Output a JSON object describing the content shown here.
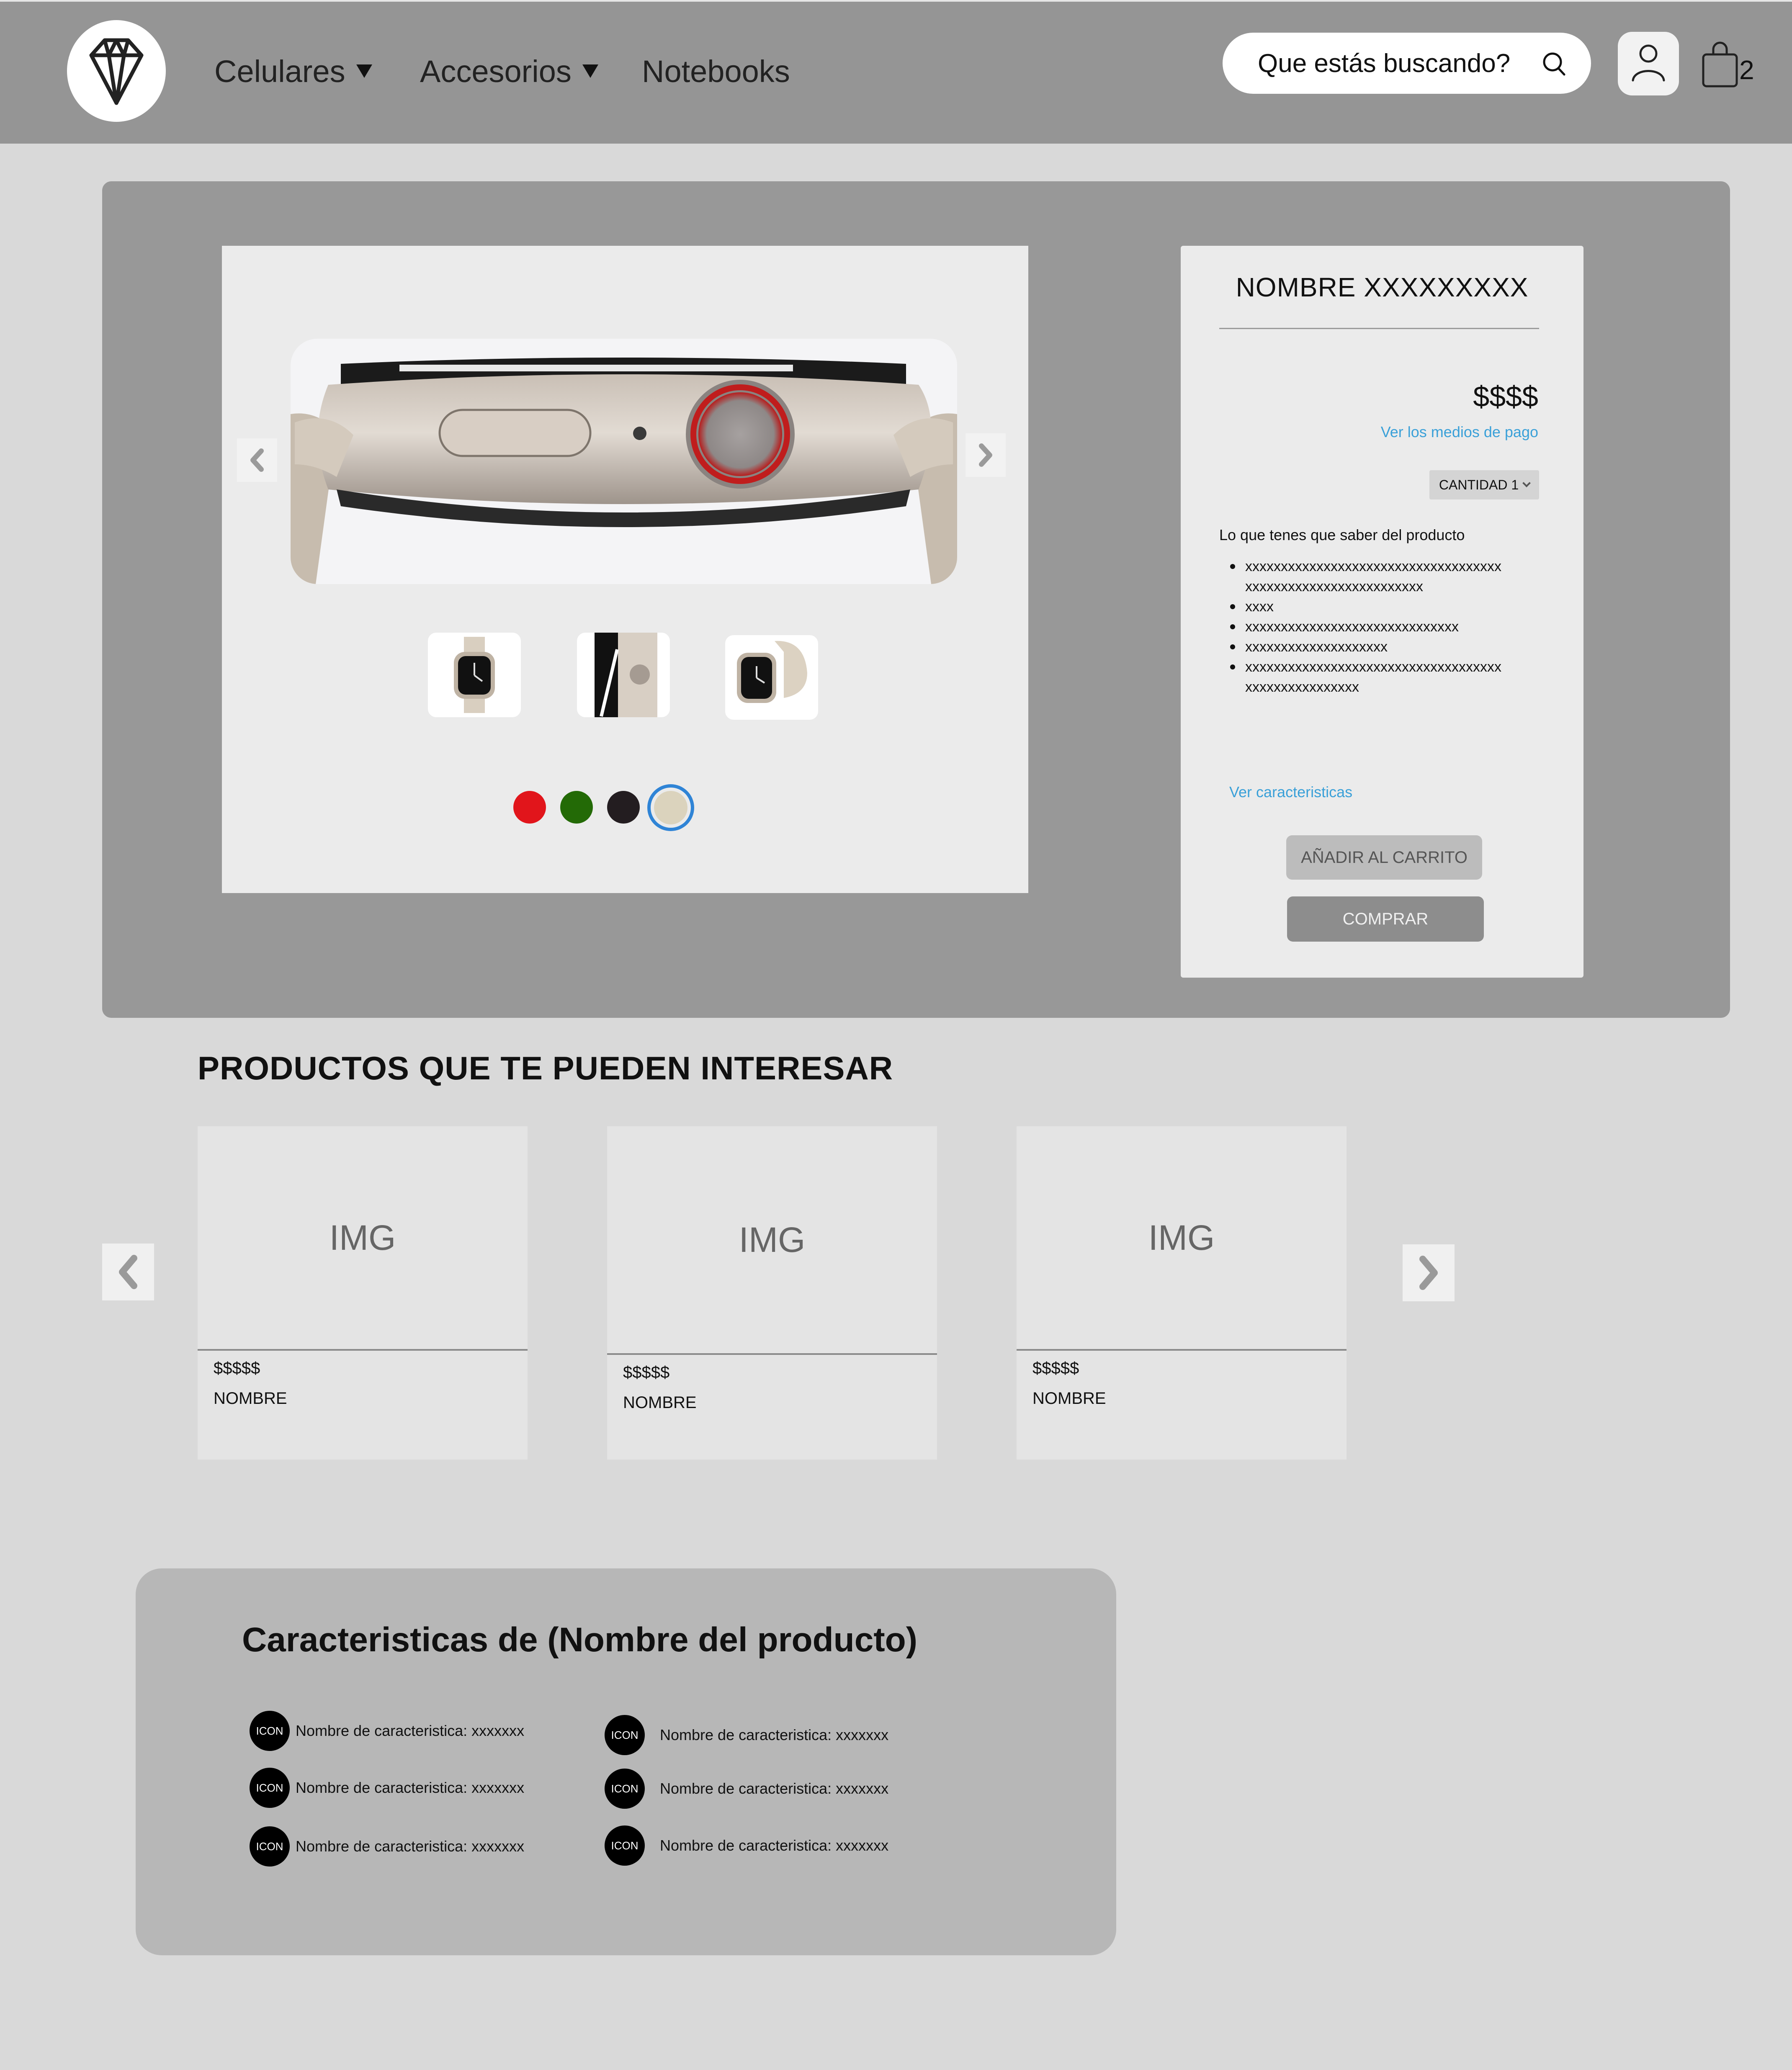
{
  "nav": {
    "items": [
      {
        "label": "Celulares"
      },
      {
        "label": "Accesorios"
      },
      {
        "label": "Notebooks"
      }
    ],
    "search_placeholder": "Que estás buscando?",
    "cart_count": "2"
  },
  "product": {
    "name": "NOMBRE XXXXXXXXX",
    "price": "$$$$",
    "payment_link": "Ver los medios de pago",
    "quantity_label": "CANTIDAD 1",
    "know_title": "Lo que tenes que saber del producto",
    "know_items": [
      "xxxxxxxxxxxxxxxxxxxxxxxxxxxxxxxxxxxxxxxxxxxxxxxxxxxxxxxxxxxxx",
      "xxxx",
      "xxxxxxxxxxxxxxxxxxxxxxxxxxxxxx",
      "xxxxxxxxxxxxxxxxxxxx",
      "xxxxxxxxxxxxxxxxxxxxxxxxxxxxxxxxxxxxxxxxxxxxxxxxxxxx"
    ],
    "specs_link": "Ver caracteristicas",
    "add_to_cart": "AÑADIR AL CARRITO",
    "buy": "COMPRAR",
    "colors": [
      "#e1151b",
      "#236a06",
      "#231d20",
      "#dbd3bd"
    ],
    "selected_color_index": 3
  },
  "related": {
    "title": "PRODUCTOS QUE TE PUEDEN INTERESAR",
    "cards": [
      {
        "img": "IMG",
        "price": "$$$$$",
        "name": "NOMBRE"
      },
      {
        "img": "IMG",
        "price": "$$$$$",
        "name": "NOMBRE"
      },
      {
        "img": "IMG",
        "price": "$$$$$",
        "name": "NOMBRE"
      }
    ]
  },
  "features": {
    "title": "Caracteristicas de (Nombre del producto)",
    "icon_label": "ICON",
    "items": [
      "Nombre de caracteristica: xxxxxxx",
      "Nombre de caracteristica: xxxxxxx",
      "Nombre de caracteristica: xxxxxxx",
      "Nombre de caracteristica: xxxxxxx",
      "Nombre de caracteristica: xxxxxxx",
      "Nombre de caracteristica: xxxxxxx"
    ]
  }
}
